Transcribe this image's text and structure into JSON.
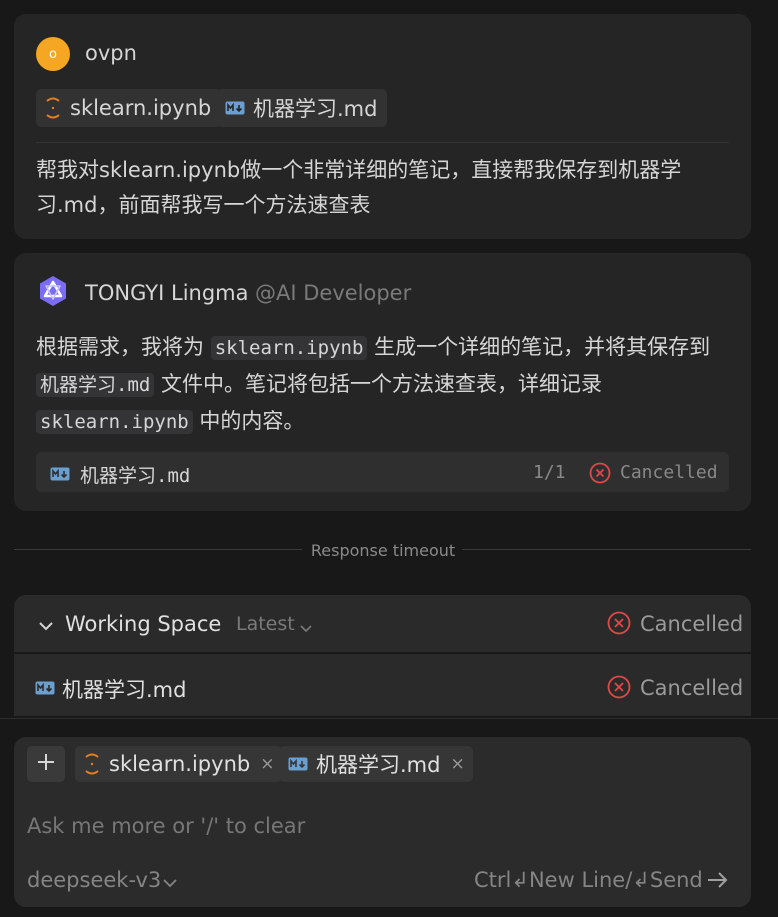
{
  "user_message": {
    "avatar_letter": "o",
    "username": "ovpn",
    "attachments": [
      {
        "icon": "jupyter-notebook-icon",
        "name": "sklearn.ipynb"
      },
      {
        "icon": "markdown-file-icon",
        "name": "机器学习.md"
      }
    ],
    "text": "帮我对sklearn.ipynb做一个非常详细的笔记，直接帮我保存到机器学习.md，前面帮我写一个方法速查表"
  },
  "assistant_message": {
    "name": "TONGYI Lingma",
    "tag": "@AI Developer",
    "text_parts": [
      "根据需求，我将为 ",
      "sklearn.ipynb",
      " 生成一个详细的笔记，并将其保存到 ",
      "机器学习.md",
      " 文件中。笔记将包括一个方法速查表，详细记录 ",
      "sklearn.ipynb",
      " 中的内容。"
    ],
    "file_card": {
      "icon": "markdown-file-icon",
      "name": "机器学习.md",
      "count": "1/1",
      "status": "Cancelled"
    }
  },
  "timeout_notice": "Response timeout",
  "working_space": {
    "title": "Working Space",
    "version": "Latest",
    "status": "Cancelled",
    "files": [
      {
        "icon": "markdown-file-icon",
        "name": "机器学习.md",
        "status": "Cancelled"
      }
    ]
  },
  "composer": {
    "attachments": [
      {
        "icon": "jupyter-notebook-icon",
        "name": "sklearn.ipynb",
        "close": "×"
      },
      {
        "icon": "markdown-file-icon",
        "name": "机器学习.md",
        "close": "×"
      }
    ],
    "placeholder": "Ask me more or '/' to clear",
    "model": "deepseek-v3",
    "shortcut_hint": "Ctrl↲New Line/↲Send"
  },
  "colors": {
    "avatar": "#f5a623",
    "cancel_red": "#e04848",
    "bot_logo": "#7b6cf6",
    "jupyter_orange": "#e67e22",
    "markdown_blue": "#6a9fcf"
  }
}
